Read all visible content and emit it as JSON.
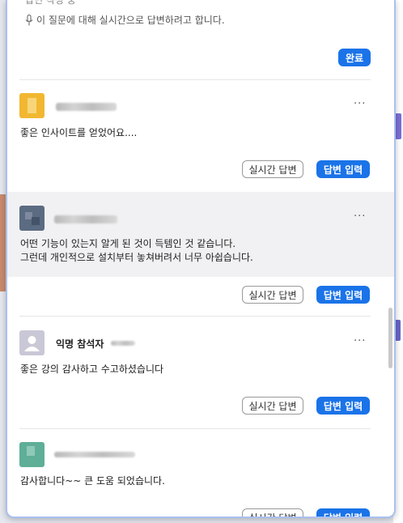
{
  "reply_hint": "이 질문에 대해 실시간으로 답변하려고 합니다.",
  "top_clipped_text": "답변 작성 중",
  "done_label": "완료",
  "more_label": "···",
  "live_label": "실시간 답변",
  "answer_label": "답변 입력",
  "questions": [
    {
      "message": "좋은 인사이트를 얻었어요....",
      "avatar_color": "#f2b731"
    },
    {
      "message": "어떤 기능이 있는지 알게 된 것이 득템인 것 같습니다.\n그런데 개인적으로 설치부터 놓쳐버려서 너무 아쉽습니다.",
      "avatar_color": "#5b6b82"
    },
    {
      "name": "익명 참석자",
      "message": "좋은 강의 감사하고 수고하셨습니다",
      "avatar_color": "#c9c8d6"
    },
    {
      "message": "감사합니다~~ 큰 도움 되었습니다.",
      "avatar_color": "#5fae97"
    }
  ],
  "colors": {
    "primary": "#1a73e8",
    "frame_border": "#a9c0f0"
  }
}
